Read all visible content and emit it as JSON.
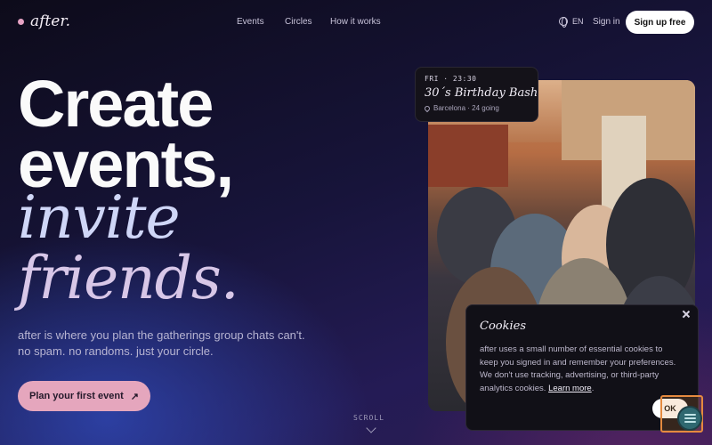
{
  "nav": {
    "logo": "after.",
    "links": [
      "Events",
      "Circles",
      "How it works"
    ],
    "language": "EN",
    "sign_in": "Sign in",
    "sign_up": "Sign up free"
  },
  "hero": {
    "line1": "Create",
    "line2": "events,",
    "line3": "invite",
    "line4": "friends.",
    "subtitle_line1": "after is where you plan the gatherings group chats can't.",
    "subtitle_line2": "no spam. no randoms. just your circle.",
    "cta": "Plan your first event",
    "cta_arrow": "↗",
    "scroll": "SCROLL"
  },
  "event_card": {
    "when": "FRI · 23:30",
    "title": "30´s Birthday Bash",
    "meta": "Barcelona · 24 going"
  },
  "cookies": {
    "title": "Cookies",
    "text": "after uses a small number of essential cookies to keep you signed in and remember your preferences. We don't use tracking, advertising, or third-party analytics cookies.",
    "link": "Learn more",
    "link_suffix": ".",
    "ok": "OK"
  },
  "colors": {
    "accent_pink": "#e5a6bd",
    "bg_dark": "#0d0b1a"
  }
}
